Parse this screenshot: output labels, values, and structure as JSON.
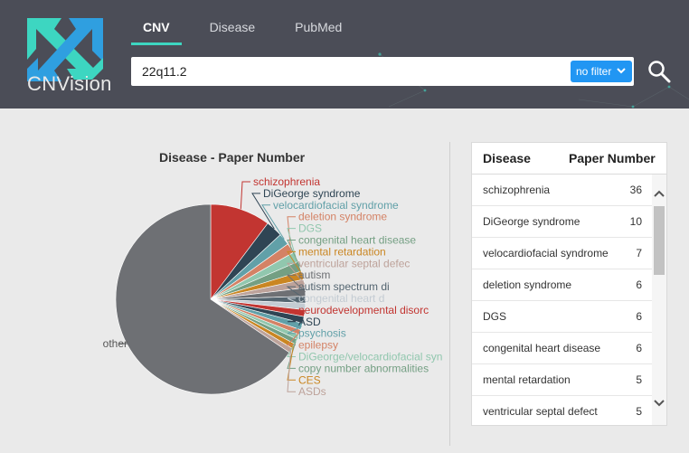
{
  "app": {
    "logo_text": "CNVision"
  },
  "nav": {
    "tabs": [
      {
        "label": "CNV",
        "active": true
      },
      {
        "label": "Disease",
        "active": false
      },
      {
        "label": "PubMed",
        "active": false
      }
    ]
  },
  "search": {
    "value": "22q11.2",
    "filter_label": "no filter"
  },
  "colors": {
    "header": "#4b4d57",
    "accent": "#3dd6c1",
    "filter": "#2196f3"
  },
  "chart_data": {
    "type": "pie",
    "title": "Disease - Paper Number",
    "slices": [
      {
        "label": "schizophrenia",
        "value": 36,
        "color": "#c23531"
      },
      {
        "label": "DiGeorge syndrome",
        "value": 10,
        "color": "#2f4554"
      },
      {
        "label": "velocardiofacial syndrome",
        "value": 7,
        "color": "#61a0a8"
      },
      {
        "label": "deletion syndrome",
        "value": 6,
        "color": "#d48265"
      },
      {
        "label": "DGS",
        "value": 6,
        "color": "#91c7ae"
      },
      {
        "label": "congenital heart disease",
        "value": 6,
        "color": "#749f83"
      },
      {
        "label": "mental retardation",
        "value": 5,
        "color": "#ca8622"
      },
      {
        "label": "ventricular septal defec",
        "value": 5,
        "color": "#bda29a"
      },
      {
        "label": "autism",
        "value": 5,
        "color": "#6e7074"
      },
      {
        "label": "autism spectrum di",
        "value": 4,
        "color": "#546570"
      },
      {
        "label": "congenital heart d",
        "value": 4,
        "color": "#c4ccd3"
      },
      {
        "label": "neurodevelopmental disorc",
        "value": 4,
        "color": "#c23531"
      },
      {
        "label": "ASD",
        "value": 4,
        "color": "#2f4554"
      },
      {
        "label": "psychosis",
        "value": 4,
        "color": "#61a0a8"
      },
      {
        "label": "epilepsy",
        "value": 3,
        "color": "#d48265"
      },
      {
        "label": "DiGeorge/velocardiofacial syn",
        "value": 3,
        "color": "#91c7ae"
      },
      {
        "label": "copy number abnormalities",
        "value": 3,
        "color": "#749f83"
      },
      {
        "label": "CES",
        "value": 3,
        "color": "#ca8622"
      },
      {
        "label": "ASDs",
        "value": 3,
        "color": "#bda29a"
      },
      {
        "label": "other",
        "value": 230,
        "color": "#6e7074"
      }
    ]
  },
  "table": {
    "headers": {
      "disease": "Disease",
      "count": "Paper Number"
    },
    "rows": [
      {
        "disease": "schizophrenia",
        "count": "36"
      },
      {
        "disease": "DiGeorge syndrome",
        "count": "10"
      },
      {
        "disease": "velocardiofacial syndrome",
        "count": "7"
      },
      {
        "disease": "deletion syndrome",
        "count": "6"
      },
      {
        "disease": "DGS",
        "count": "6"
      },
      {
        "disease": "congenital heart disease",
        "count": "6"
      },
      {
        "disease": "mental retardation",
        "count": "5"
      },
      {
        "disease": "ventricular septal defect",
        "count": "5"
      }
    ]
  }
}
